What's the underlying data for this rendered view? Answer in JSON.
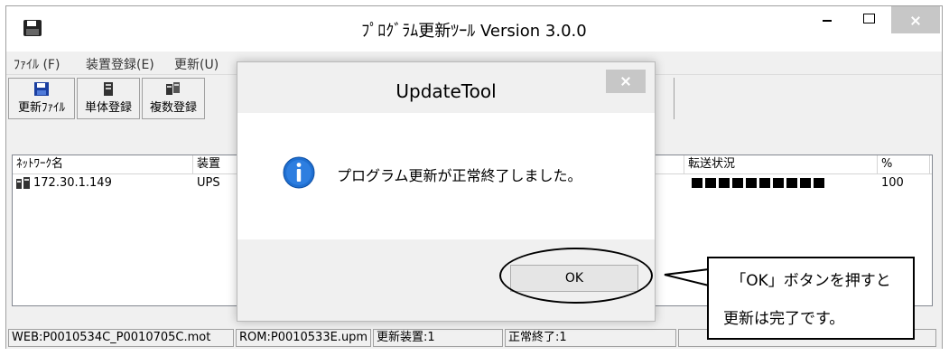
{
  "window": {
    "title": "ﾌﾟﾛｸﾞﾗﾑ更新ﾂｰﾙ Version 3.0.0",
    "icon": "save-disk-icon",
    "controls": [
      "minimize-icon",
      "maximize-icon",
      "close-icon"
    ]
  },
  "menu": {
    "file": "ﾌｧｲﾙ (F)",
    "device_register": "装置登録(E)",
    "update": "更新(U)"
  },
  "toolbar": {
    "update_file": {
      "label": "更新ﾌｧｲﾙ",
      "icon": "floppy-disk-icon"
    },
    "single_register": {
      "label": "単体登録",
      "icon": "device-icon"
    },
    "multi_register": {
      "label": "複数登録",
      "icon": "multi-device-icon"
    }
  },
  "list": {
    "columns": {
      "network_name": "ﾈｯﾄﾜｰｸ名",
      "device": "装置",
      "transfer_status": "転送状況",
      "percent": "%"
    },
    "rows": [
      {
        "network_name": "172.30.1.149",
        "device": "UPS",
        "progress_blocks": 10,
        "percent": "100"
      }
    ]
  },
  "statusbar": {
    "web_file": "WEB:P0010534C_P0010705C.mot",
    "rom_file": "ROM:P0010533E.upm",
    "update_devices": "更新装置:1",
    "normal_end": "正常終了:1"
  },
  "dialog": {
    "title": "UpdateTool",
    "message": "プログラム更新が正常終了しました。",
    "ok_label": "OK",
    "icon": "info-icon"
  },
  "callout": {
    "line1": "「OK」ボタンを押すと",
    "line2": "更新は完了です。"
  },
  "colors": {
    "window_bg": "#f0f0f0",
    "close_button": "#c7c7c7",
    "info_blue": "#1f6fd0",
    "progress_block": "#000000"
  }
}
